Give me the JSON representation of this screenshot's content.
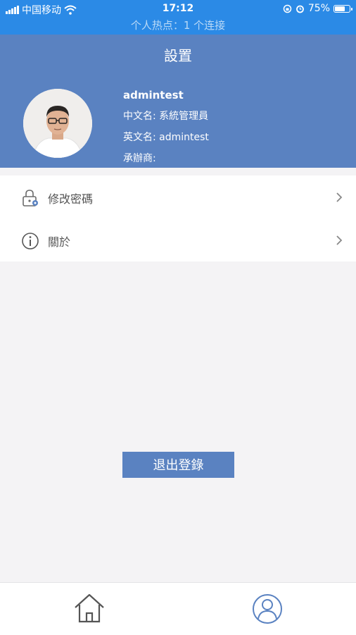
{
  "status_bar": {
    "carrier": "中国移动",
    "time": "17:12",
    "battery": "75%",
    "battery_level": 0.75
  },
  "hotspot": {
    "text": "个人热点：1 个连接"
  },
  "header": {
    "title": "設置",
    "username": "admintest",
    "chinese_name": "中文名: 系統管理員",
    "english_name": "英文名: admintest",
    "contractor": "承辦商:"
  },
  "menu": {
    "items": [
      {
        "label": "修改密碼",
        "icon": "lock-gear-icon"
      },
      {
        "label": "關於",
        "icon": "info-icon"
      }
    ]
  },
  "logout": {
    "label": "退出登錄"
  },
  "tabbar": {
    "items": [
      {
        "icon": "home-icon"
      },
      {
        "icon": "profile-icon"
      }
    ]
  },
  "colors": {
    "status_bar": "#2b8ae6",
    "header": "#5a82c1",
    "background": "#f4f3f5",
    "button": "#5a82c1"
  }
}
